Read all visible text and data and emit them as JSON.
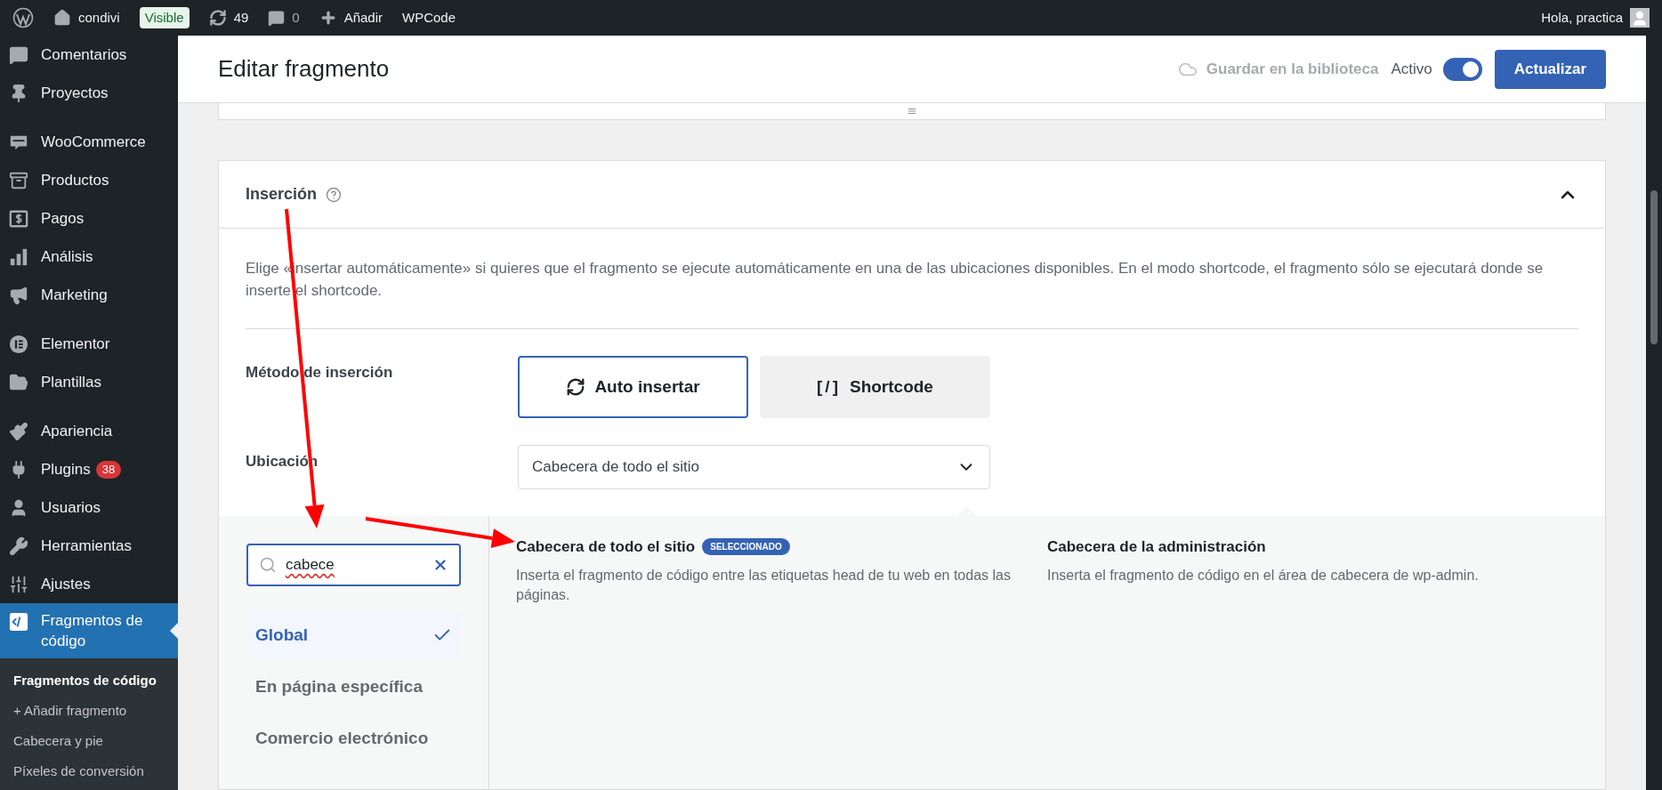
{
  "admin_bar": {
    "items": [
      {
        "kind": "logo"
      },
      {
        "kind": "site",
        "label": "condivi"
      },
      {
        "kind": "badge",
        "label": "Visible"
      },
      {
        "kind": "updates",
        "label": "49"
      },
      {
        "kind": "comments",
        "label": "0"
      },
      {
        "kind": "new",
        "label": "Añadir"
      },
      {
        "kind": "text",
        "label": "WPCode"
      }
    ],
    "greeting": "Hola, practica"
  },
  "sidebar": {
    "groups": [
      [
        {
          "kind": "comments",
          "label": "Comentarios",
          "selected": false
        },
        {
          "kind": "pin",
          "label": "Proyectos",
          "selected": false
        }
      ],
      [
        {
          "kind": "woo",
          "label": "WooCommerce",
          "selected": false
        },
        {
          "kind": "archive",
          "label": "Productos",
          "selected": false
        },
        {
          "kind": "dollar",
          "label": "Pagos",
          "selected": false
        },
        {
          "kind": "bars",
          "label": "Análisis",
          "selected": false
        },
        {
          "kind": "megaphone",
          "label": "Marketing",
          "selected": false
        }
      ],
      [
        {
          "kind": "elementor",
          "label": "Elementor",
          "selected": false
        },
        {
          "kind": "folder",
          "label": "Plantillas",
          "selected": false
        }
      ],
      [
        {
          "kind": "brush",
          "label": "Apariencia",
          "selected": false
        },
        {
          "kind": "plug",
          "label": "Plugins",
          "selected": false,
          "badge": "38"
        },
        {
          "kind": "user",
          "label": "Usuarios",
          "selected": false
        },
        {
          "kind": "wrench",
          "label": "Herramientas",
          "selected": false
        },
        {
          "kind": "sliders",
          "label": "Ajustes",
          "selected": false
        },
        {
          "kind": "code",
          "label": "Fragmentos de código",
          "selected": true
        }
      ]
    ],
    "submenu": [
      {
        "label": "Fragmentos de código",
        "selected": true
      },
      {
        "label": "+ Añadir fragmento",
        "selected": false
      },
      {
        "label": "Cabecera y pie",
        "selected": false
      },
      {
        "label": "Píxeles de conversión",
        "selected": false
      }
    ]
  },
  "header": {
    "title": "Editar fragmento",
    "library_button": {
      "label": "Guardar en la biblioteca",
      "disabled": true
    },
    "toggle": {
      "label": "Activo",
      "on": true
    },
    "primary_button": "Actualizar"
  },
  "insertion": {
    "title": "Inserción",
    "expanded": true,
    "description": "Elige «insertar automáticamente» si quieres que el fragmento se ejecute automáticamente en una de las ubicaciones disponibles. En el modo shortcode, el fragmento sólo se ejecutará donde se inserte el shortcode.",
    "method": {
      "label": "Método de inserción",
      "options": [
        {
          "kind": "auto",
          "label": "Auto insertar",
          "selected": true
        },
        {
          "kind": "shortcode",
          "symbol": "[/]",
          "label": "Shortcode",
          "selected": false
        }
      ]
    },
    "location": {
      "label": "Ubicación",
      "value": "Cabecera de todo el sitio"
    },
    "picker": {
      "search": {
        "value": "cabece"
      },
      "categories": [
        {
          "label": "Global",
          "selected": true
        },
        {
          "label": "En página específica",
          "selected": false
        },
        {
          "label": "Comercio electrónico",
          "selected": false
        }
      ],
      "locations": [
        {
          "title": "Cabecera de todo el sitio",
          "badge": "SELECCIONADO",
          "description": "Inserta el fragmento de código entre las etiquetas head de tu web en todas las páginas."
        },
        {
          "title": "Cabecera de la administración",
          "description": "Inserta el fragmento de código en el área de cabecera de wp-admin."
        }
      ]
    }
  }
}
